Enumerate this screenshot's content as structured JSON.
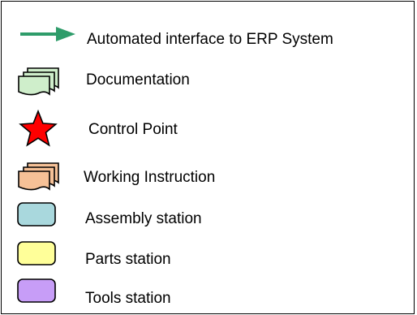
{
  "legend": {
    "items": [
      {
        "id": "erp",
        "icon": "arrow-right-icon",
        "label": "Automated interface to ERP System",
        "color": "#2e9c6a"
      },
      {
        "id": "doc",
        "icon": "document-stack-icon",
        "label": "Documentation",
        "color": "#cfeecb"
      },
      {
        "id": "control",
        "icon": "star-icon",
        "label": "Control Point",
        "color": "#ff0000"
      },
      {
        "id": "work",
        "icon": "document-stack-icon",
        "label": "Working Instruction",
        "color": "#f6c197"
      },
      {
        "id": "assembly",
        "icon": "rounded-rect-icon",
        "label": "Assembly station",
        "color": "#a9d8dd"
      },
      {
        "id": "parts",
        "icon": "rounded-rect-icon",
        "label": "Parts station",
        "color": "#ffff99"
      },
      {
        "id": "tools",
        "icon": "rounded-rect-icon",
        "label": "Tools station",
        "color": "#c79df7"
      }
    ]
  }
}
